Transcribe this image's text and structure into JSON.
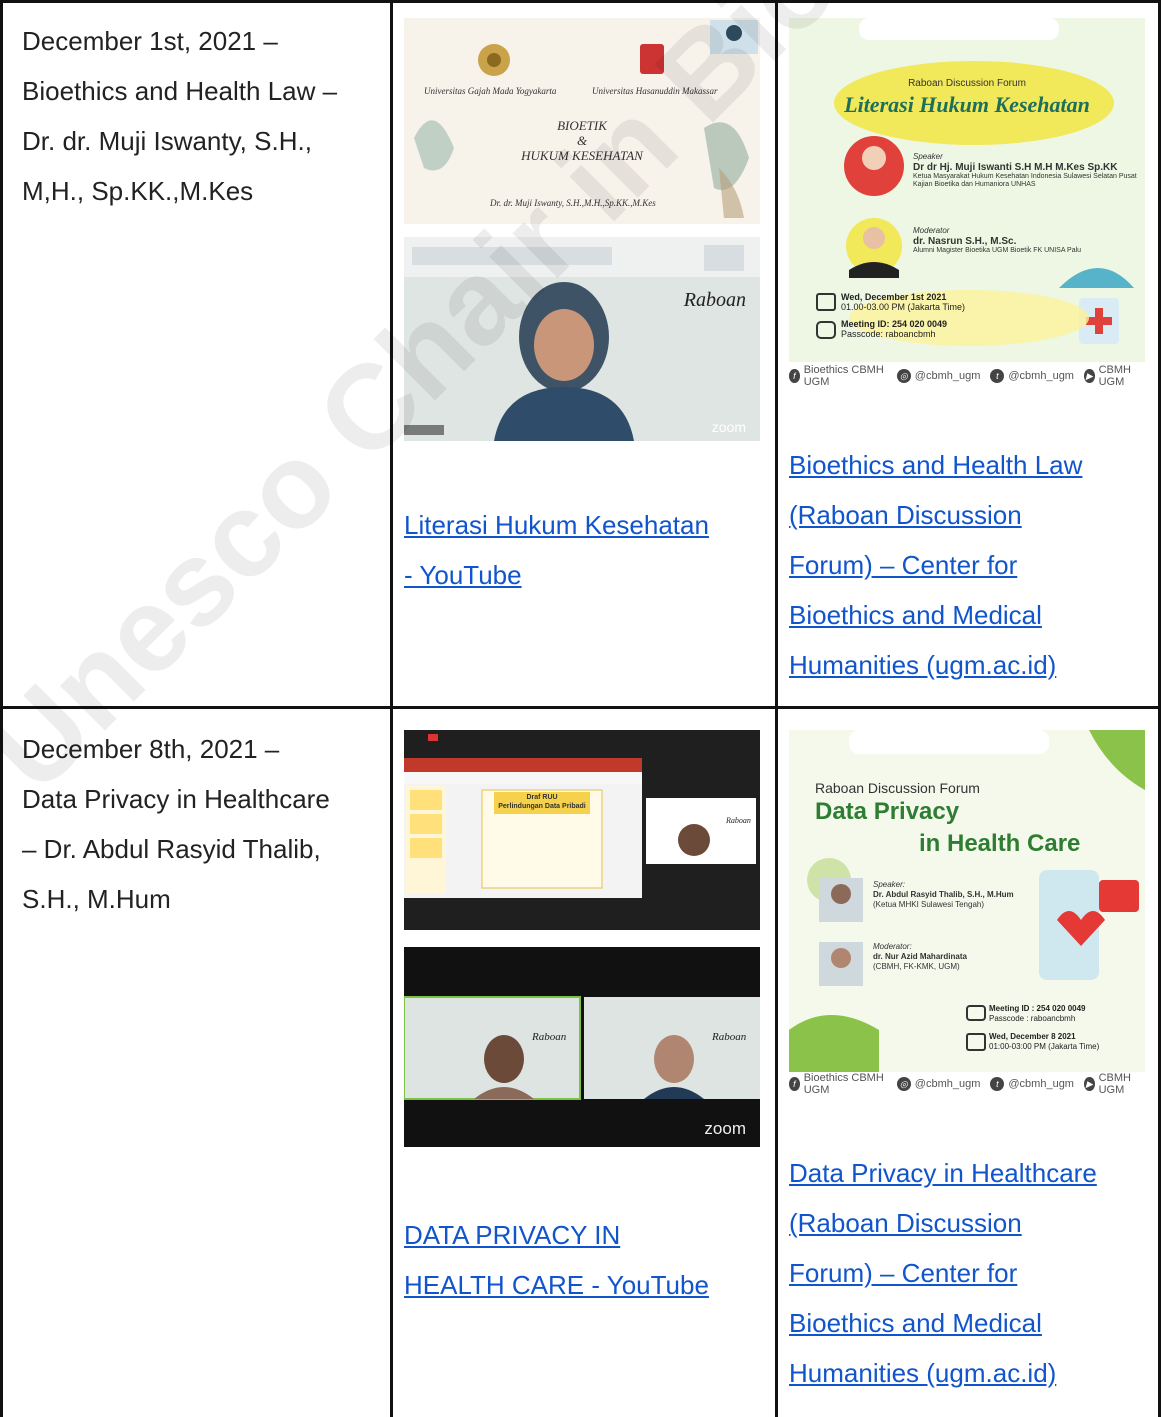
{
  "rows": [
    {
      "description": [
        "December 1st, 2021 –",
        "Bioethics and Health Law –",
        "Dr. dr. Muji Iswanty, S.H.,",
        "M,H., Sp.KK.,M.Kes"
      ],
      "slide_top": {
        "univ_left": "Universitas Gajah Mada Yogyakarta",
        "univ_right": "Universitas Hasanuddin Makassar",
        "title_lines": [
          "BIOETIK",
          "&",
          "HUKUM KESEHATAN"
        ],
        "author": "Dr. dr. Muji Iswanty, S.H.,M.H.,Sp.KK.,M.Kes"
      },
      "zoom_label": "Raboan",
      "zoom_brand": "zoom",
      "youtube_link": [
        "Literasi Hukum Kesehatan",
        "- YouTube"
      ],
      "poster": {
        "forum": "Raboan Discussion Forum",
        "title": "Literasi Hukum Kesehatan",
        "speaker_role": "Speaker",
        "speaker": "Dr dr Hj. Muji Iswanti S.H M.H M.Kes Sp.KK",
        "speaker_desc": "Ketua Masyarakat Hukum Kesehatan Indonesia Sulawesi Selatan Pusat Kajian Bioetika dan Humaniora UNHAS",
        "moderator_role": "Moderator",
        "moderator": "dr. Nasrun S.H., M.Sc.",
        "moderator_desc": "Alumni Magister Bioetika UGM Bioetik FK UNISA Palu",
        "date": "Wed, December 1st 2021",
        "time": "01.00-03.00 PM (Jakarta Time)",
        "meeting": "Meeting ID: 254 020 0049",
        "passcode": "Passcode: raboancbmh"
      },
      "center_link": [
        "Bioethics and Health Law",
        "(Raboan Discussion",
        "Forum) – Center for",
        "Bioethics and Medical",
        "Humanities (ugm.ac.id)"
      ]
    },
    {
      "description": [
        "December 8th, 2021 –",
        "Data Privacy in Healthcare",
        "– Dr. Abdul Rasyid Thalib,",
        "S.H., M.Hum"
      ],
      "slide_top": {
        "title_lines": [
          "Draf RUU",
          "Perlindungan Data Pribadi"
        ]
      },
      "zoom_label": "Raboan",
      "zoom_brand": "zoom",
      "youtube_link": [
        "DATA PRIVACY IN",
        "HEALTH CARE - YouTube"
      ],
      "poster": {
        "forum": "Raboan Discussion Forum",
        "title_1": "Data Privacy",
        "title_2": "in Health Care",
        "speaker_role": "Speaker:",
        "speaker": "Dr. Abdul Rasyid Thalib, S.H., M.Hum",
        "speaker_desc": "(Ketua MHKI Sulawesi Tengah)",
        "moderator_role": "Moderator:",
        "moderator": "dr. Nur Azid Mahardinata",
        "moderator_desc": "(CBMH, FK-KMK, UGM)",
        "meeting": "Meeting ID : 254 020 0049",
        "passcode": "Passcode : raboancbmh",
        "date": "Wed, December 8 2021",
        "time": "01:00-03:00 PM (Jakarta Time)"
      },
      "center_link": [
        "Data Privacy in Healthcare",
        "(Raboan Discussion",
        "Forum) – Center for",
        "Bioethics and Medical",
        "Humanities (ugm.ac.id)"
      ]
    }
  ],
  "social": {
    "facebook": "Bioethics CBMH UGM",
    "instagram": "@cbmh_ugm",
    "twitter": "@cbmh_ugm",
    "youtube": "CBMH UGM"
  },
  "watermark": "Unesco Chair in Bioethics UGM"
}
